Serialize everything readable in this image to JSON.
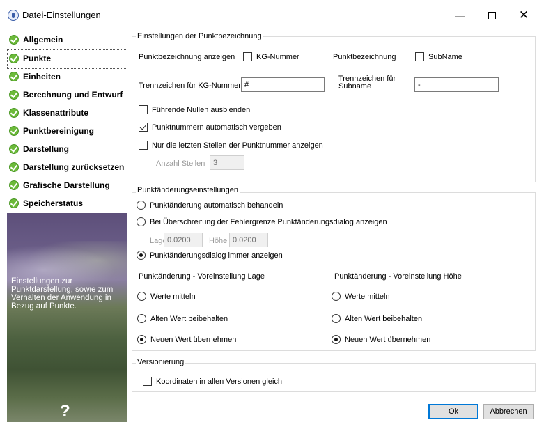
{
  "window": {
    "title": "Datei-Einstellungen",
    "minimize_glyph": "—",
    "close_glyph": "✕"
  },
  "sidebar": {
    "items": [
      {
        "label": "Allgemein"
      },
      {
        "label": "Punkte"
      },
      {
        "label": "Einheiten"
      },
      {
        "label": "Berechnung und Entwurf"
      },
      {
        "label": "Klassenattribute"
      },
      {
        "label": "Punktbereinigung"
      },
      {
        "label": "Darstellung"
      },
      {
        "label": "Darstellung zurücksetzen"
      },
      {
        "label": "Grafische Darstellung"
      },
      {
        "label": "Speicherstatus"
      }
    ],
    "active_index": 1,
    "description": "Einstellungen zur Punktdarstellung, sowie zum Verhalten der Anwendung in Bezug auf Punkte.",
    "help_glyph": "?"
  },
  "group_bezeichnung": {
    "title": "Einstellungen der Punktbezeichnung",
    "show_label": "Punktbezeichnung anzeigen",
    "kg_label": "KG-Nummer",
    "punktbez_label": "Punktbezeichnung",
    "subname_label": "SubName",
    "trenn_kg_label": "Trennzeichen für KG-Nummer",
    "trenn_kg_value": "#",
    "trenn_sub_label_1": "Trennzeichen für",
    "trenn_sub_label_2": "Subname",
    "trenn_sub_value": "-",
    "nullen_label": "Führende Nullen ausblenden",
    "auto_label": "Punktnummern automatisch vergeben",
    "letzte_label": "Nur die letzten Stellen der Punktnummer anzeigen",
    "anzahl_label": "Anzahl Stellen",
    "anzahl_value": "3"
  },
  "group_aenderung": {
    "title": "Punktänderungseinstellungen",
    "opt1": "Punktänderung automatisch behandeln",
    "opt2": "Bei Überschreitung der Fehlergrenze Punktänderungsdialog anzeigen",
    "lage_label": "Lage",
    "lage_value": "0.0200",
    "hoehe_label": "Höhe",
    "hoehe_value": "0.0200",
    "opt3": "Punktänderungsdialog immer anzeigen",
    "lage_col_title": "Punktänderung - Voreinstellung Lage",
    "hoehe_col_title": "Punktänderung - Voreinstellung Höhe",
    "werte_mitteln": "Werte mitteln",
    "alten_wert": "Alten Wert beibehalten",
    "neuen_wert": "Neuen Wert übernehmen"
  },
  "group_version": {
    "title": "Versionierung",
    "koord_label": "Koordinaten in allen Versionen gleich"
  },
  "buttons": {
    "ok": "Ok",
    "cancel": "Abbrechen"
  }
}
